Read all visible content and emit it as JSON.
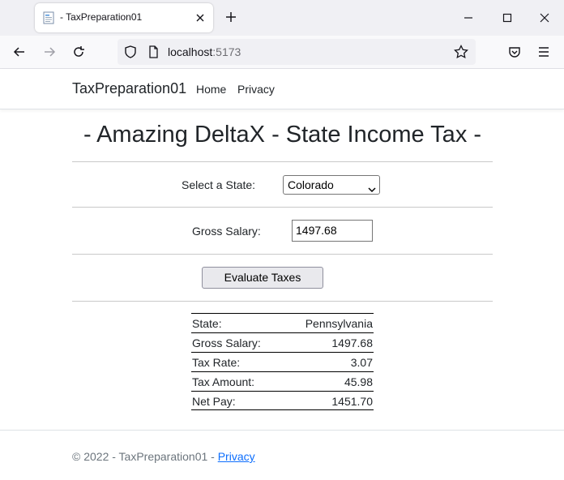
{
  "browser": {
    "tab_title": "- TaxPreparation01",
    "url_host": "localhost",
    "url_port": ":5173"
  },
  "site": {
    "brand": "TaxPreparation01",
    "nav": [
      "Home",
      "Privacy"
    ]
  },
  "main": {
    "title": "- Amazing DeltaX - State Income Tax -",
    "state_label": "Select a State:",
    "state_value": "Colorado",
    "salary_label": "Gross Salary:",
    "salary_value": "1497.68",
    "evaluate_button": "Evaluate Taxes"
  },
  "results": [
    {
      "label": "State:",
      "value": "Pennsylvania"
    },
    {
      "label": "Gross Salary:",
      "value": "1497.68"
    },
    {
      "label": "Tax Rate:",
      "value": "3.07"
    },
    {
      "label": "Tax Amount:",
      "value": "45.98"
    },
    {
      "label": "Net Pay:",
      "value": "1451.70"
    }
  ],
  "footer": {
    "copyright": "© 2022 - TaxPreparation01 - ",
    "privacy_link": "Privacy"
  }
}
